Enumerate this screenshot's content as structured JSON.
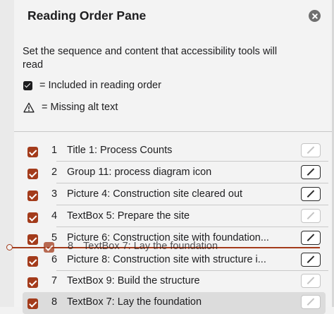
{
  "pane": {
    "title": "Reading Order Pane",
    "description": "Set the sequence and content that accessibility tools will read",
    "legend": {
      "included": "= Included in reading order",
      "missing_alt": "= Missing alt text"
    }
  },
  "accent_color": "#a33b1b",
  "items": [
    {
      "num": "1",
      "label": "Title 1: Process Counts",
      "checked": true,
      "edit_active": false
    },
    {
      "num": "2",
      "label": "Group 11: process diagram icon",
      "checked": true,
      "edit_active": true
    },
    {
      "num": "3",
      "label": "Picture 4: Construction site cleared out",
      "checked": true,
      "edit_active": true
    },
    {
      "num": "4",
      "label": "TextBox 5: Prepare the site",
      "checked": true,
      "edit_active": false
    },
    {
      "num": "5",
      "label": "Picture 6: Construction site with foundation...",
      "checked": true,
      "edit_active": true
    },
    {
      "num": "6",
      "label": "Picture 8: Construction site with structure i...",
      "checked": true,
      "edit_active": true
    },
    {
      "num": "7",
      "label": "TextBox 9: Build the structure",
      "checked": true,
      "edit_active": false
    },
    {
      "num": "8",
      "label": "TextBox 7: Lay the foundation",
      "checked": true,
      "edit_active": false,
      "selected": true
    }
  ],
  "drag_ghost": {
    "num": "8",
    "label": "TextBox 7: Lay the foundation"
  }
}
